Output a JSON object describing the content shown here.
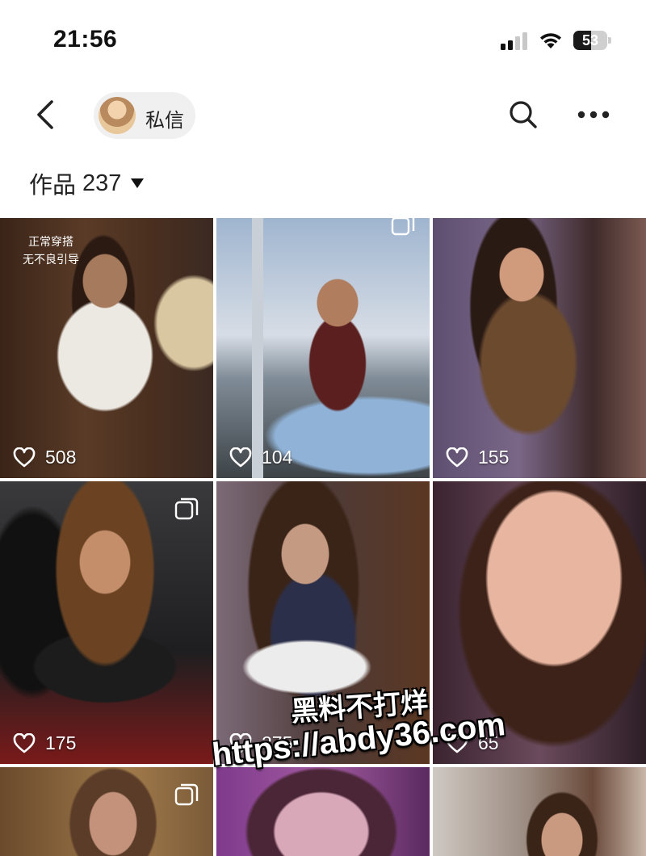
{
  "status_bar": {
    "time": "21:56",
    "battery_level": "53",
    "battery_fraction": 0.53
  },
  "nav": {
    "dm_label": "私信"
  },
  "works": {
    "label": "作品",
    "count": "237"
  },
  "tiles": [
    {
      "likes": "508",
      "caption_line1": "正常穿搭",
      "caption_line2": "无不良引导",
      "multi_image": false
    },
    {
      "likes": "104",
      "multi_image": true
    },
    {
      "likes": "155",
      "multi_image": false
    },
    {
      "likes": "175",
      "multi_image": true
    },
    {
      "likes": "275",
      "multi_image": false
    },
    {
      "likes": "65",
      "multi_image": false
    },
    {
      "likes": "",
      "multi_image": true
    },
    {
      "likes": "",
      "multi_image": false
    },
    {
      "likes": "",
      "multi_image": false
    }
  ],
  "watermark": {
    "line1": "黑料不打烊",
    "line2": "https://abdy36.com"
  },
  "icons": [
    "back-arrow-icon",
    "search-icon",
    "more-icon",
    "heart-icon",
    "multi-image-icon",
    "signal-icon",
    "wifi-icon",
    "battery-icon"
  ]
}
